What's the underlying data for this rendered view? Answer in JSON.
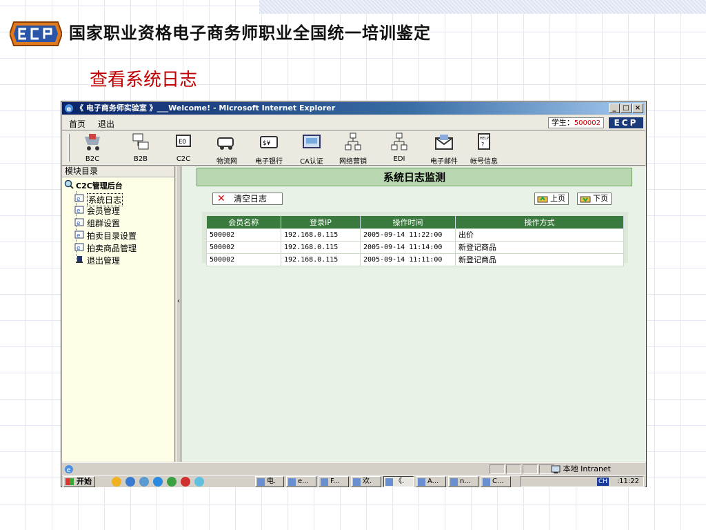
{
  "slide": {
    "header": "国家职业资格电子商务师职业全国统一培训鉴定",
    "title": "查看系统日志",
    "logo_text": "ECP"
  },
  "window": {
    "title": "《 电子商务师实验室 》___Welcome! - Microsoft Internet Explorer",
    "buttons": [
      "_",
      "□",
      "×"
    ]
  },
  "menubar": {
    "items": [
      "首页",
      "退出"
    ],
    "student_label": "学生：",
    "student_id": "500002",
    "brand": "ECP"
  },
  "toolbar": {
    "items": [
      {
        "label": "B2C",
        "icon": "shopping-cart-icon"
      },
      {
        "label": "B2B",
        "icon": "b2b-network-icon"
      },
      {
        "label": "C2C",
        "icon": "c2c-icon"
      },
      {
        "label": "物流网",
        "icon": "truck-icon"
      },
      {
        "label": "电子银行",
        "icon": "bank-icon"
      },
      {
        "label": "CA认证",
        "icon": "certificate-icon"
      },
      {
        "label": "网络营销",
        "icon": "marketing-icon"
      },
      {
        "label": "EDI",
        "icon": "edi-icon"
      },
      {
        "label": "电子邮件",
        "icon": "email-icon"
      },
      {
        "label": "帐号信息",
        "icon": "help-account-icon"
      }
    ]
  },
  "sidebar": {
    "header": "模块目录",
    "root": "C2C管理后台",
    "items": [
      {
        "label": "系统日志",
        "selected": true
      },
      {
        "label": "会员管理"
      },
      {
        "label": "组群设置"
      },
      {
        "label": "拍卖目录设置"
      },
      {
        "label": "拍卖商品管理"
      },
      {
        "label": "退出管理"
      }
    ]
  },
  "content": {
    "heading": "系统日志监测",
    "clear_button": "清空日志",
    "prev_button": "上页",
    "next_button": "下页",
    "table": {
      "headers": [
        "会员名称",
        "登录IP",
        "操作时间",
        "操作方式"
      ],
      "rows": [
        [
          "500002",
          "192.168.0.115",
          "2005-09-14 11:22:00",
          "出价"
        ],
        [
          "500002",
          "192.168.0.115",
          "2005-09-14 11:14:00",
          "新登记商品"
        ],
        [
          "500002",
          "192.168.0.115",
          "2005-09-14 11:11:00",
          "新登记商品"
        ]
      ]
    }
  },
  "statusbar": {
    "zone": "本地 Intranet"
  },
  "taskbar": {
    "start": "开始",
    "tasks": [
      "电.",
      "e...",
      "F...",
      "欢.",
      "《.",
      "A...",
      "n...",
      "C..."
    ],
    "lang": "CH",
    "clock": ":11:22"
  },
  "colors": {
    "slide_title": "#c00000",
    "table_header": "#3a7a3e",
    "content_bg": "#e9f2e6",
    "heading_bg": "#b9d8b2"
  }
}
